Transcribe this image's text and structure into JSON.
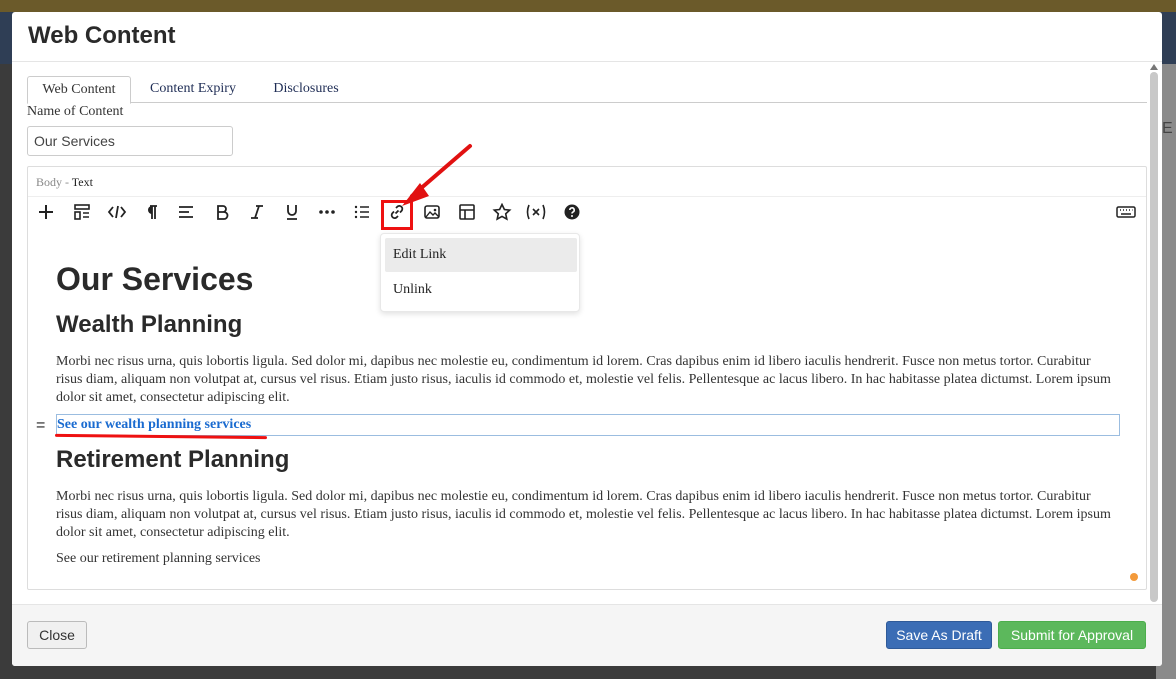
{
  "modal": {
    "title": "Web Content"
  },
  "tabs": [
    {
      "label": "Web Content",
      "active": true
    },
    {
      "label": "Content Expiry",
      "active": false
    },
    {
      "label": "Disclosures",
      "active": false
    }
  ],
  "name_field": {
    "label": "Name of Content",
    "value": "Our Services"
  },
  "editor": {
    "label_prefix": "Body -",
    "label_type": "Text",
    "toolbar": [
      {
        "icon": "plus-icon",
        "glyph": "+"
      },
      {
        "icon": "layout-icon",
        "glyph": "▤"
      },
      {
        "icon": "code-icon",
        "glyph": "</>"
      },
      {
        "icon": "paragraph-icon",
        "glyph": "¶"
      },
      {
        "icon": "align-icon",
        "glyph": "≡"
      },
      {
        "icon": "bold-icon",
        "glyph": "B"
      },
      {
        "icon": "italic-icon",
        "glyph": "I"
      },
      {
        "icon": "underline-icon",
        "glyph": "U"
      },
      {
        "icon": "more-icon",
        "glyph": "•••"
      },
      {
        "icon": "list-icon",
        "glyph": "☰"
      },
      {
        "icon": "link-icon",
        "glyph": "🔗"
      },
      {
        "icon": "image-icon",
        "glyph": "▣"
      },
      {
        "icon": "table-icon",
        "glyph": "⊞"
      },
      {
        "icon": "star-icon",
        "glyph": "☆"
      },
      {
        "icon": "variable-icon",
        "glyph": "(x)"
      },
      {
        "icon": "help-icon",
        "glyph": "?"
      },
      {
        "icon": "keyboard-icon",
        "glyph": "⌨"
      }
    ],
    "link_menu": {
      "edit_label": "Edit Link",
      "unlink_label": "Unlink"
    },
    "content": {
      "heading": "Our Services",
      "section1_heading": "Wealth Planning",
      "section1_body": "Morbi nec risus urna, quis lobortis ligula. Sed dolor mi, dapibus nec molestie eu, condimentum id lorem. Cras dapibus enim id libero iaculis hendrerit. Fusce non metus tortor. Curabitur risus diam, aliquam non volutpat at, cursus vel risus. Etiam justo risus, iaculis id commodo et, molestie vel felis. Pellentesque ac lacus libero. In hac habitasse platea dictumst. Lorem ipsum dolor sit amet, consectetur adipiscing elit.",
      "section1_link": "See our wealth planning services",
      "section2_heading": "Retirement Planning",
      "section2_body": "Morbi nec risus urna, quis lobortis ligula. Sed dolor mi, dapibus nec molestie eu, condimentum id lorem. Cras dapibus enim id libero iaculis hendrerit. Fusce non metus tortor. Curabitur risus diam, aliquam non volutpat at, cursus vel risus. Etiam justo risus, iaculis id commodo et, molestie vel felis. Pellentesque ac lacus libero. In hac habitasse platea dictumst. Lorem ipsum dolor sit amet, consectetur adipiscing elit.",
      "section2_link_text": "See our retirement planning services"
    }
  },
  "footer": {
    "close_label": "Close",
    "draft_label": "Save As Draft",
    "submit_label": "Submit for Approval"
  },
  "colors": {
    "draft_button": "#3b6db5",
    "submit_button": "#5cb85c",
    "link": "#1a6bd0",
    "annotation": "#e11111"
  }
}
